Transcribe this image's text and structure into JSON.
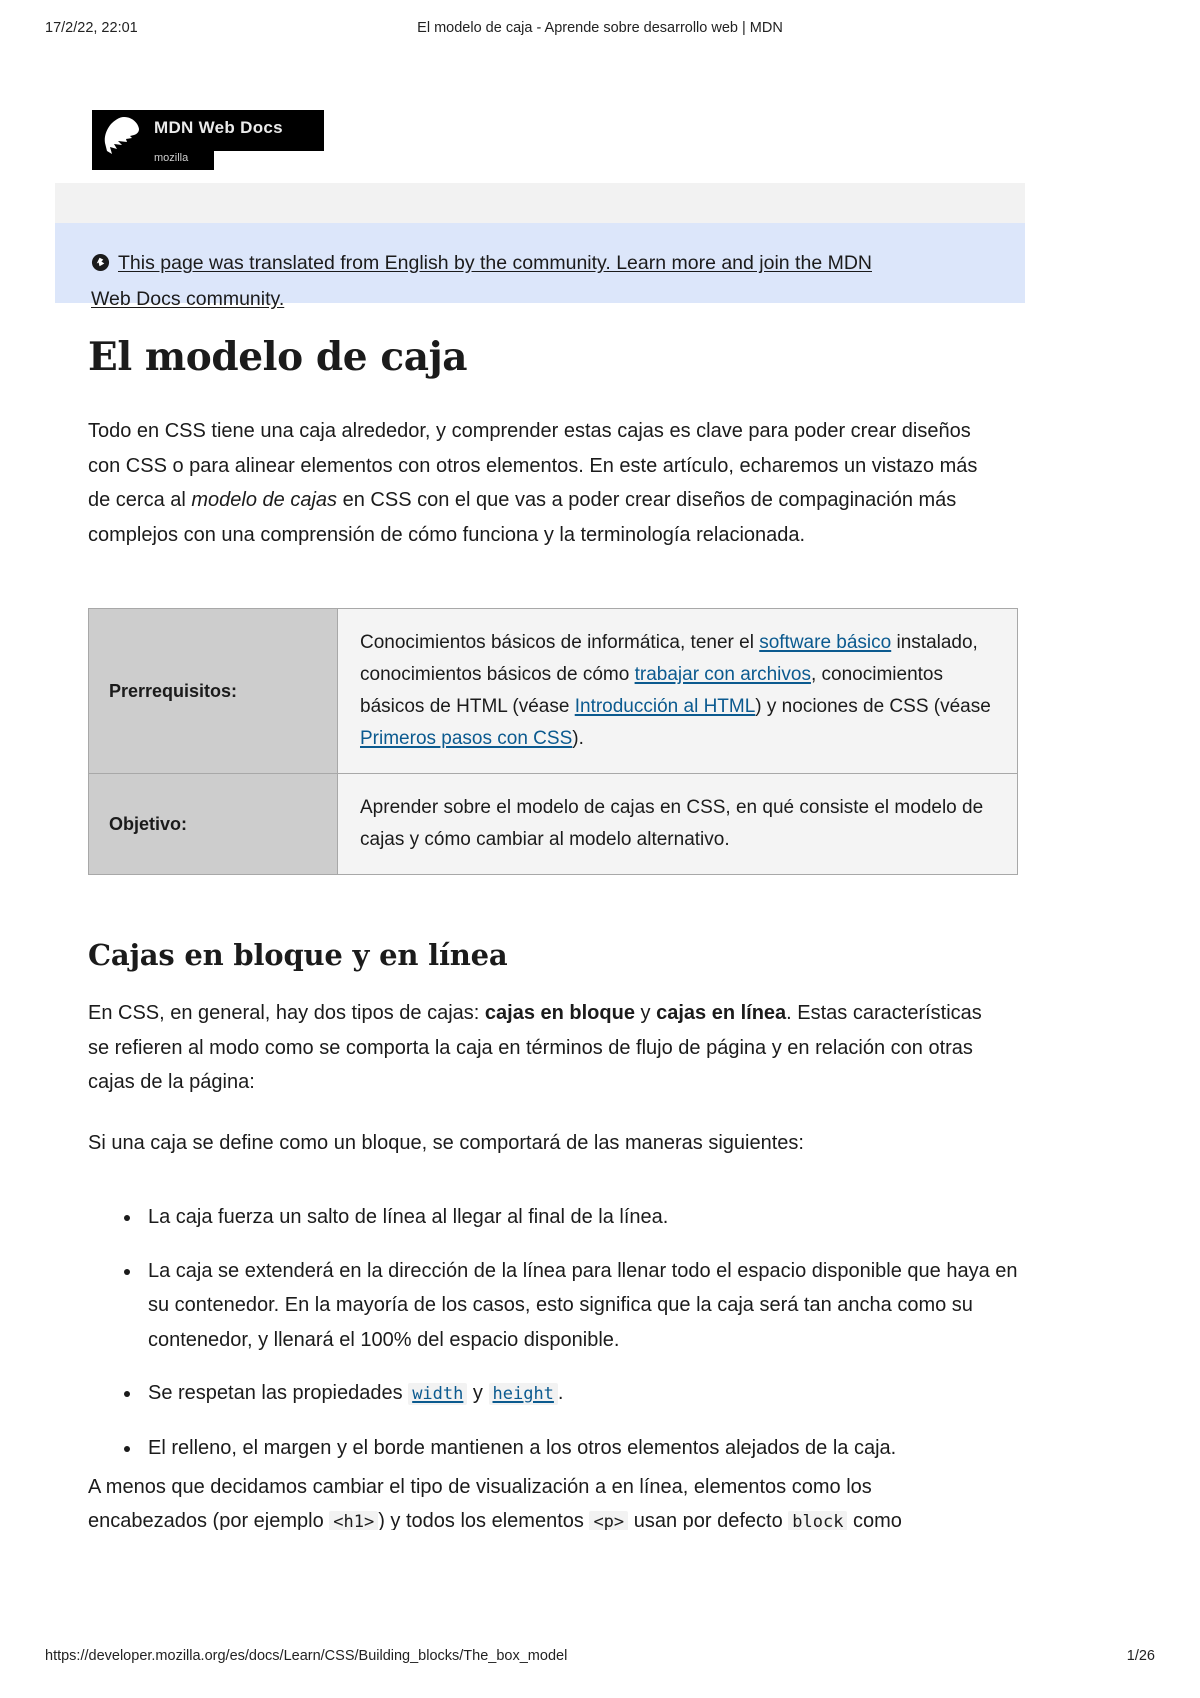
{
  "print": {
    "date": "17/2/22, 22:01",
    "doc_title": "El modelo de caja - Aprende sobre desarrollo web | MDN",
    "footer_url": "https://developer.mozilla.org/es/docs/Learn/CSS/Building_blocks/The_box_model",
    "page_number": "1/26"
  },
  "logo": {
    "brand": "MDN Web Docs",
    "sub": "mozilla",
    "icon": "dinosaur-head-icon"
  },
  "banner": {
    "icon": "globe-icon",
    "text_line1": "This page was translated from English by the community. Learn more and join the MDN",
    "text_line2": "Web Docs community.",
    "background_color": "#dce6fa"
  },
  "article": {
    "title": "El modelo de caja",
    "intro": {
      "part1": "Todo en CSS tiene una caja alrededor, y comprender estas cajas es clave para poder crear diseños con CSS o para alinear elementos con otros elementos. En este artículo, echaremos un vistazo más de cerca al ",
      "emphasis": "modelo de cajas",
      "part2": " en CSS con el que vas a poder crear diseños de compaginación más complejos con una comprensión de cómo funciona y la terminología relacionada."
    },
    "table": {
      "rows": [
        {
          "label": "Prerrequisitos:",
          "t1": "Conocimientos básicos de informática, tener el ",
          "l1": "software básico",
          "t2": " instalado, conocimientos básicos de cómo ",
          "l2": "trabajar con archivos",
          "t3": ", conocimientos básicos de HTML (véase ",
          "l3": "Introducción al HTML",
          "t4": ") y nociones de CSS (véase ",
          "l4": "Primeros pasos con CSS",
          "t5": ")."
        },
        {
          "label": "Objetivo:",
          "t1": "Aprender sobre el modelo de cajas en CSS, en qué consiste el modelo de cajas y cómo cambiar al modelo alternativo."
        }
      ]
    },
    "section_boxes": {
      "heading": "Cajas en bloque y en línea",
      "p_types_a": "En CSS, en general, hay dos tipos de cajas: ",
      "p_types_b": "cajas en bloque",
      "p_types_c": " y ",
      "p_types_d": "cajas en línea",
      "p_types_e": ". Estas características se refieren al modo como se comporta la caja en términos de flujo de página y en relación con otras cajas de la página:",
      "p_define": "Si una caja se define como un bloque, se comportará de las maneras siguientes:",
      "bullets": [
        {
          "text": "La caja fuerza un salto de línea al llegar al final de la línea."
        },
        {
          "text": "La caja se extenderá en la dirección de la línea para llenar todo el espacio disponible que haya en su contenedor. En la mayoría de los casos, esto significa que la caja será tan ancha como su contenedor, y llenará el 100% del espacio disponible."
        },
        {
          "pre": "Se respetan las propiedades ",
          "code1": "width",
          "mid": " y ",
          "code2": "height",
          "post": "."
        },
        {
          "text": "El relleno, el margen y el borde mantienen a los otros elementos alejados de la caja."
        }
      ],
      "p_unless": "A menos que decidamos cambiar el tipo de visualización a en línea, elementos como los",
      "clipped_a": "encabezados (por ejemplo ",
      "clipped_code1": "<h1>",
      "clipped_b": ") y todos los elementos ",
      "clipped_code2": "<p>",
      "clipped_c": " usan por defecto ",
      "clipped_code3": "block",
      "clipped_d": " como"
    }
  },
  "colors": {
    "link": "#0b5a8f",
    "banner_bg": "#dce6fa",
    "table_label_bg": "#cdcdcd",
    "table_value_bg": "#f4f4f4",
    "search_bg": "#f2f2f2"
  }
}
